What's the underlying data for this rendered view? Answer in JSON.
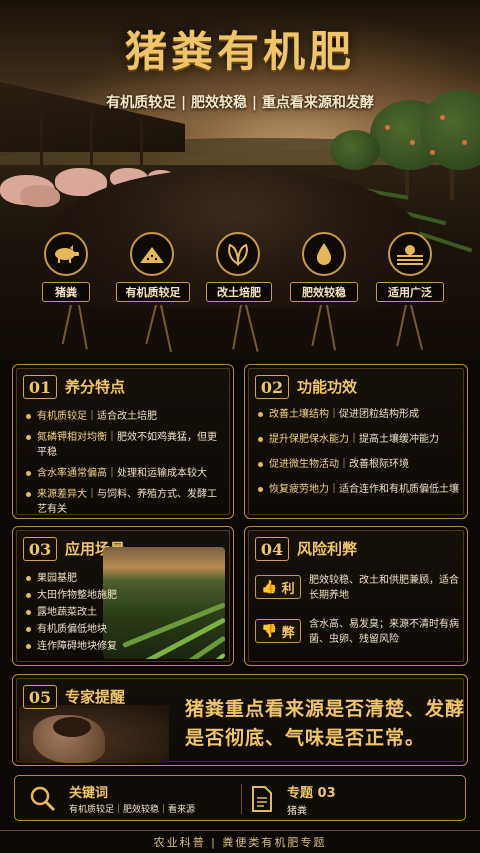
{
  "header": {
    "title": "猪粪有机肥",
    "subtitle": "有机质较足 | 肥效较稳 | 重点看来源和发酵"
  },
  "features": [
    {
      "icon": "pig-icon",
      "label": "猪粪"
    },
    {
      "icon": "powder-pile-icon",
      "label": "有机质较足"
    },
    {
      "icon": "leaf-icon",
      "label": "改土培肥"
    },
    {
      "icon": "drop-icon",
      "label": "肥效较稳"
    },
    {
      "icon": "farmland-icon",
      "label": "适用广泛"
    }
  ],
  "section1": {
    "num": "01",
    "title": "养分特点",
    "items": [
      {
        "head": "有机质较足",
        "tail": "｜适合改土培肥"
      },
      {
        "head": "氮磷钾相对均衡",
        "tail": "｜肥效不如鸡粪猛，但更平稳"
      },
      {
        "head": "含水率通常偏高",
        "tail": "｜处理和运输成本较大"
      },
      {
        "head": "来源差异大",
        "tail": "｜与饲料、养殖方式、发酵工艺有关"
      }
    ]
  },
  "section2": {
    "num": "02",
    "title": "功能功效",
    "items": [
      {
        "head": "改善土壤结构",
        "tail": "｜促进团粒结构形成"
      },
      {
        "head": "提升保肥保水能力",
        "tail": "｜提高土壤缓冲能力"
      },
      {
        "head": "促进微生物活动",
        "tail": "｜改善根际环境"
      },
      {
        "head": "恢复疲劳地力",
        "tail": "｜适合连作和有机质偏低土壤"
      }
    ]
  },
  "section3": {
    "num": "03",
    "title": "应用场景",
    "items": [
      "果园基肥",
      "大田作物整地施肥",
      "露地蔬菜改土",
      "有机质偏低地块",
      "连作障碍地块修复"
    ]
  },
  "section4": {
    "num": "04",
    "title": "风险利弊",
    "pros_label": "利",
    "pros_text": "肥效较稳、改土和供肥兼顾，适合长期养地",
    "cons_label": "弊",
    "cons_text": "含水高、易发臭；来源不清时有病菌、虫卵、残留风险"
  },
  "section5": {
    "num": "05",
    "title": "专家提醒",
    "text": "猪粪重点看来源是否清楚、发酵是否彻底、气味是否正常。"
  },
  "footer": {
    "keyword_title": "关键词",
    "keywords": "有机质较足｜肥效较稳｜看来源",
    "topic_title": "专题 03",
    "topic_name": "猪粪",
    "bottom": "农业科普 | 粪便类有机肥专题"
  },
  "colors": {
    "gold": "#e5b95a",
    "background": "#0b0805",
    "frame": "#b8893f"
  }
}
